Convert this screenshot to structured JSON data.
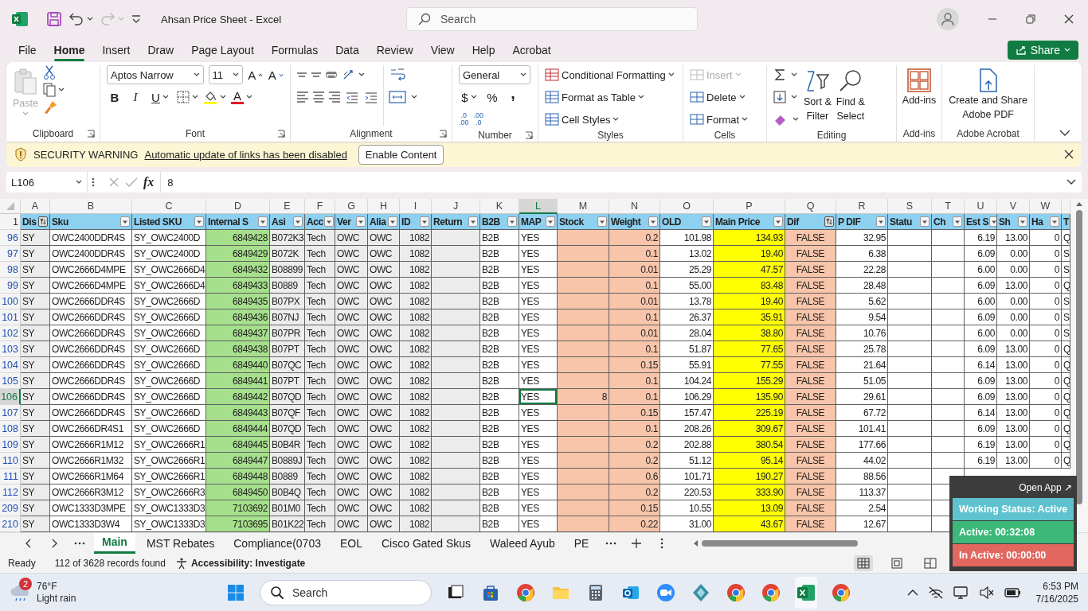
{
  "window": {
    "title": "Ahsan Price Sheet  -  Excel",
    "search_placeholder": "Search"
  },
  "menu_tabs": [
    {
      "label": "File",
      "selected": false
    },
    {
      "label": "Home",
      "selected": true
    },
    {
      "label": "Insert",
      "selected": false
    },
    {
      "label": "Draw",
      "selected": false
    },
    {
      "label": "Page Layout",
      "selected": false
    },
    {
      "label": "Formulas",
      "selected": false
    },
    {
      "label": "Data",
      "selected": false
    },
    {
      "label": "Review",
      "selected": false
    },
    {
      "label": "View",
      "selected": false
    },
    {
      "label": "Help",
      "selected": false
    },
    {
      "label": "Acrobat",
      "selected": false
    }
  ],
  "share_button": "Share",
  "ribbon": {
    "clipboard": {
      "label": "Clipboard",
      "paste": {
        "label": "Paste",
        "disabled": true
      }
    },
    "font": {
      "label": "Font",
      "name": "Aptos Narrow",
      "size": "11",
      "grow": "A",
      "shrink": "A",
      "bold": "B",
      "italic": "I",
      "underline": "U",
      "font_color": "A"
    },
    "alignment": {
      "label": "Alignment"
    },
    "number": {
      "label": "Number",
      "format": "General",
      "currency": "$",
      "percent": "%",
      "comma": ",",
      "decimals": [
        {
          "top": ".0",
          "bottom": ".00"
        },
        {
          "top": ".00",
          "bottom": ".0"
        }
      ]
    },
    "styles": {
      "label": "Styles",
      "items": [
        "Conditional Formatting",
        "Format as Table",
        "Cell Styles"
      ]
    },
    "cells": {
      "label": "Cells",
      "items": [
        {
          "label": "Insert",
          "disabled": true
        },
        {
          "label": "Delete",
          "disabled": false
        },
        {
          "label": "Format",
          "disabled": false
        }
      ]
    },
    "editing": {
      "label": "Editing",
      "sort": [
        "Sort &",
        "Filter"
      ],
      "find": [
        "Find &",
        "Select"
      ]
    },
    "addins": {
      "label": "Add-ins",
      "button": "Add-ins"
    },
    "acrobat": {
      "label": "Adobe Acrobat",
      "button": [
        "Create and Share",
        "Adobe PDF"
      ]
    }
  },
  "security_bar": {
    "title": "SECURITY WARNING",
    "message": "Automatic update of links has been disabled",
    "button": "Enable Content"
  },
  "formula_bar": {
    "name_box": "L106",
    "fx": "fx",
    "value": "8"
  },
  "table": {
    "header_row": "1",
    "columns": [
      {
        "letter": "A",
        "header": "Dis",
        "kind": "text",
        "filtered": true,
        "selected": false,
        "color": "#ececec"
      },
      {
        "letter": "B",
        "header": "Sku",
        "kind": "text",
        "filtered": false,
        "selected": false
      },
      {
        "letter": "C",
        "header": "Listed SKU",
        "kind": "text",
        "filtered": false,
        "selected": false
      },
      {
        "letter": "D",
        "header": "Internal S",
        "kind": "number",
        "filtered": false,
        "selected": false,
        "color": "#a6e08c"
      },
      {
        "letter": "E",
        "header": "Asi",
        "kind": "text",
        "filtered": false,
        "selected": false,
        "color": "#ececec"
      },
      {
        "letter": "F",
        "header": "Acc",
        "kind": "text",
        "filtered": false,
        "selected": false,
        "color": "#ececec"
      },
      {
        "letter": "G",
        "header": "Ver",
        "kind": "text",
        "filtered": false,
        "selected": false,
        "color": "#ececec"
      },
      {
        "letter": "H",
        "header": "Alia",
        "kind": "text",
        "filtered": false,
        "selected": false,
        "color": "#ececec"
      },
      {
        "letter": "I",
        "header": "ID",
        "kind": "number",
        "filtered": false,
        "selected": false,
        "color": "#ececec"
      },
      {
        "letter": "J",
        "header": "Return",
        "kind": "text",
        "filtered": false,
        "selected": false,
        "color": "#ececec"
      },
      {
        "letter": "K",
        "header": "B2B",
        "kind": "text",
        "filtered": false,
        "selected": false
      },
      {
        "letter": "L",
        "header": "MAP",
        "kind": "text",
        "filtered": false,
        "selected": true
      },
      {
        "letter": "M",
        "header": "Stock",
        "kind": "number",
        "filtered": false,
        "selected": false,
        "color": "#f8c5aa"
      },
      {
        "letter": "N",
        "header": "Weight",
        "kind": "number",
        "filtered": false,
        "selected": false,
        "color": "#f8c5aa"
      },
      {
        "letter": "O",
        "header": "OLD",
        "kind": "number",
        "filtered": false,
        "selected": false
      },
      {
        "letter": "P",
        "header": "Main Price",
        "kind": "number",
        "filtered": false,
        "selected": false,
        "color": "#ffff00"
      },
      {
        "letter": "Q",
        "header": "Dif",
        "kind": "bool",
        "filtered": true,
        "selected": false,
        "color": "#f8c5aa"
      },
      {
        "letter": "R",
        "header": "P DIF",
        "kind": "number",
        "filtered": false,
        "selected": false
      },
      {
        "letter": "S",
        "header": "Statu",
        "kind": "text",
        "filtered": false,
        "selected": false
      },
      {
        "letter": "T",
        "header": "Ch",
        "kind": "text",
        "filtered": false,
        "selected": false
      },
      {
        "letter": "U",
        "header": "Est S",
        "kind": "number",
        "filtered": false,
        "selected": false
      },
      {
        "letter": "V",
        "header": "Sh",
        "kind": "number",
        "filtered": false,
        "selected": false
      },
      {
        "letter": "W",
        "header": "Ha",
        "kind": "number",
        "filtered": false,
        "selected": false
      },
      {
        "header": "T",
        "kind": "text"
      }
    ],
    "rows": [
      {
        "number": "96",
        "selected": false,
        "cells": [
          "SY",
          "OWC2400DDR4S",
          "SY_OWC2400D",
          "6849428",
          "B072K3",
          "Tech",
          "OWC",
          "OWC",
          "1082",
          null,
          "B2B",
          "YES",
          null,
          "0.2",
          "101.98",
          "134.93",
          "FALSE",
          "32.95",
          null,
          null,
          "6.19",
          "13.00",
          "0",
          "Q"
        ]
      },
      {
        "number": "97",
        "selected": false,
        "cells": [
          "SY",
          "OWC2400DDR4S",
          "SY_OWC2400D",
          "6849429",
          "B072K",
          "Tech",
          "OWC",
          "OWC",
          "1082",
          null,
          "B2B",
          "YES",
          null,
          "0.1",
          "13.02",
          "19.40",
          "FALSE",
          "6.38",
          null,
          null,
          "6.09",
          "0.00",
          "0",
          "S"
        ]
      },
      {
        "number": "98",
        "selected": false,
        "cells": [
          "SY",
          "OWC2666D4MPE",
          "SY_OWC2666D4",
          "6849432",
          "B08899",
          "Tech",
          "OWC",
          "OWC",
          "1082",
          null,
          "B2B",
          "YES",
          null,
          "0.01",
          "25.29",
          "47.57",
          "FALSE",
          "22.28",
          null,
          null,
          "6.00",
          "0.00",
          "0",
          "S"
        ]
      },
      {
        "number": "99",
        "selected": false,
        "cells": [
          "SY",
          "OWC2666D4MPE",
          "SY_OWC2666D4",
          "6849433",
          "B0889",
          "Tech",
          "OWC",
          "OWC",
          "1082",
          null,
          "B2B",
          "YES",
          null,
          "0.1",
          "55.00",
          "83.48",
          "FALSE",
          "28.48",
          null,
          null,
          "6.09",
          "13.00",
          "0",
          "Q"
        ]
      },
      {
        "number": "100",
        "selected": false,
        "cells": [
          "SY",
          "OWC2666DDR4S",
          "SY_OWC2666D",
          "6849435",
          "B07PX",
          "Tech",
          "OWC",
          "OWC",
          "1082",
          null,
          "B2B",
          "YES",
          null,
          "0.01",
          "13.78",
          "19.40",
          "FALSE",
          "5.62",
          null,
          null,
          "6.00",
          "0.00",
          "0",
          "S"
        ]
      },
      {
        "number": "101",
        "selected": false,
        "cells": [
          "SY",
          "OWC2666DDR4S",
          "SY_OWC2666D",
          "6849436",
          "B07NJ",
          "Tech",
          "OWC",
          "OWC",
          "1082",
          null,
          "B2B",
          "YES",
          null,
          "0.1",
          "26.37",
          "35.91",
          "FALSE",
          "9.54",
          null,
          null,
          "6.09",
          "0.00",
          "0",
          "S"
        ]
      },
      {
        "number": "102",
        "selected": false,
        "cells": [
          "SY",
          "OWC2666DDR4S",
          "SY_OWC2666D",
          "6849437",
          "B07PR",
          "Tech",
          "OWC",
          "OWC",
          "1082",
          null,
          "B2B",
          "YES",
          null,
          "0.01",
          "28.04",
          "38.80",
          "FALSE",
          "10.76",
          null,
          null,
          "6.00",
          "0.00",
          "0",
          "S"
        ]
      },
      {
        "number": "103",
        "selected": false,
        "cells": [
          "SY",
          "OWC2666DDR4S",
          "SY_OWC2666D",
          "6849438",
          "B07PT",
          "Tech",
          "OWC",
          "OWC",
          "1082",
          null,
          "B2B",
          "YES",
          null,
          "0.1",
          "51.87",
          "77.65",
          "FALSE",
          "25.78",
          null,
          null,
          "6.09",
          "13.00",
          "0",
          "Q"
        ]
      },
      {
        "number": "104",
        "selected": false,
        "cells": [
          "SY",
          "OWC2666DDR4S",
          "SY_OWC2666D",
          "6849440",
          "B07QC",
          "Tech",
          "OWC",
          "OWC",
          "1082",
          null,
          "B2B",
          "YES",
          null,
          "0.15",
          "55.91",
          "77.55",
          "FALSE",
          "21.64",
          null,
          null,
          "6.14",
          "13.00",
          "0",
          "Q"
        ]
      },
      {
        "number": "105",
        "selected": false,
        "cells": [
          "SY",
          "OWC2666DDR4S",
          "SY_OWC2666D",
          "6849441",
          "B07PT",
          "Tech",
          "OWC",
          "OWC",
          "1082",
          null,
          "B2B",
          "YES",
          null,
          "0.1",
          "104.24",
          "155.29",
          "FALSE",
          "51.05",
          null,
          null,
          "6.09",
          "13.00",
          "0",
          "Q"
        ]
      },
      {
        "number": "106",
        "selected": true,
        "cells": [
          "SY",
          "OWC2666DDR4S",
          "SY_OWC2666D",
          "6849442",
          "B07QD",
          "Tech",
          "OWC",
          "OWC",
          "1082",
          null,
          "B2B",
          "YES",
          "8",
          "0.1",
          "106.29",
          "135.90",
          "FALSE",
          "29.61",
          null,
          null,
          "6.09",
          "13.00",
          "0",
          "Q"
        ]
      },
      {
        "number": "107",
        "selected": false,
        "cells": [
          "SY",
          "OWC2666DDR4S",
          "SY_OWC2666D",
          "6849443",
          "B07QF",
          "Tech",
          "OWC",
          "OWC",
          "1082",
          null,
          "B2B",
          "YES",
          null,
          "0.15",
          "157.47",
          "225.19",
          "FALSE",
          "67.72",
          null,
          null,
          "6.14",
          "13.00",
          "0",
          "Q"
        ]
      },
      {
        "number": "108",
        "selected": false,
        "cells": [
          "SY",
          "OWC2666DR4S1",
          "SY_OWC2666D",
          "6849444",
          "B07QD",
          "Tech",
          "OWC",
          "OWC",
          "1082",
          null,
          "B2B",
          "YES",
          null,
          "0.1",
          "208.26",
          "309.67",
          "FALSE",
          "101.41",
          null,
          null,
          "6.09",
          "13.00",
          "0",
          "Q"
        ]
      },
      {
        "number": "109",
        "selected": false,
        "cells": [
          "SY",
          "OWC2666R1M12",
          "SY_OWC2666R1",
          "6849445",
          "B0B4R",
          "Tech",
          "OWC",
          "OWC",
          "1082",
          null,
          "B2B",
          "YES",
          null,
          "0.2",
          "202.88",
          "380.54",
          "FALSE",
          "177.66",
          null,
          null,
          "6.19",
          "13.00",
          "0",
          "Q"
        ]
      },
      {
        "number": "110",
        "selected": false,
        "cells": [
          "SY",
          "OWC2666R1M32",
          "SY_OWC2666R1",
          "6849447",
          "B0889J",
          "Tech",
          "OWC",
          "OWC",
          "1082",
          null,
          "B2B",
          "YES",
          null,
          "0.2",
          "51.12",
          "95.14",
          "FALSE",
          "44.02",
          null,
          null,
          "6.19",
          "13.00",
          "0",
          "Q"
        ]
      },
      {
        "number": "111",
        "selected": false,
        "cells": [
          "SY",
          "OWC2666R1M64",
          "SY_OWC2666R1",
          "6849448",
          "B0889",
          "Tech",
          "OWC",
          "OWC",
          "1082",
          null,
          "B2B",
          "YES",
          null,
          "0.6",
          "101.71",
          "190.27",
          "FALSE",
          "88.56",
          null,
          null
        ]
      },
      {
        "number": "112",
        "selected": false,
        "cells": [
          "SY",
          "OWC2666R3M12",
          "SY_OWC2666R3",
          "6849450",
          "B0B4Q",
          "Tech",
          "OWC",
          "OWC",
          "1082",
          null,
          "B2B",
          "YES",
          null,
          "0.2",
          "220.53",
          "333.90",
          "FALSE",
          "113.37",
          null,
          null
        ]
      },
      {
        "number": "209",
        "selected": false,
        "cells": [
          "SY",
          "OWC1333D3MPE",
          "SY_OWC1333D3",
          "7103692",
          "B01M0",
          "Tech",
          "OWC",
          "OWC",
          "1082",
          null,
          "B2B",
          "YES",
          null,
          "0.15",
          "10.55",
          "13.09",
          "FALSE",
          "2.54",
          null,
          null
        ]
      },
      {
        "number": "210",
        "selected": false,
        "cells": [
          "SY",
          "OWC1333D3W4",
          "SY_OWC1333D3",
          "7103695",
          "B01K22",
          "Tech",
          "OWC",
          "OWC",
          "1082",
          null,
          "B2B",
          "YES",
          null,
          "0.22",
          "31.00",
          "43.67",
          "FALSE",
          "12.67",
          null,
          null
        ]
      }
    ]
  },
  "sheet_tabs": [
    {
      "label": "Main",
      "selected": true
    },
    {
      "label": "MST Rebates",
      "selected": false
    },
    {
      "label": "Compliance(0703",
      "selected": false
    },
    {
      "label": "EOL",
      "selected": false
    },
    {
      "label": "Cisco Gated Skus",
      "selected": false
    },
    {
      "label": "Waleed Ayub",
      "selected": false
    },
    {
      "label": "PE",
      "selected": false
    }
  ],
  "status_bar": {
    "mode": "Ready",
    "records": "112 of 3628 records found",
    "accessibility": "Accessibility: Investigate"
  },
  "tracker_widget": {
    "open_app": "Open App ↗",
    "items": [
      {
        "label": "Working Status: Active",
        "color": "#5ec3cf"
      },
      {
        "label": "Active: 00:32:08",
        "color": "#3cb878"
      },
      {
        "label": "In Active: 00:00:00",
        "color": "#e2675f"
      }
    ]
  },
  "taskbar": {
    "weather": {
      "badge": "2",
      "temperature": "76°F",
      "condition": "Light rain"
    },
    "search_placeholder": "Search",
    "time": "6:53 PM",
    "date": "7/16/2025"
  }
}
